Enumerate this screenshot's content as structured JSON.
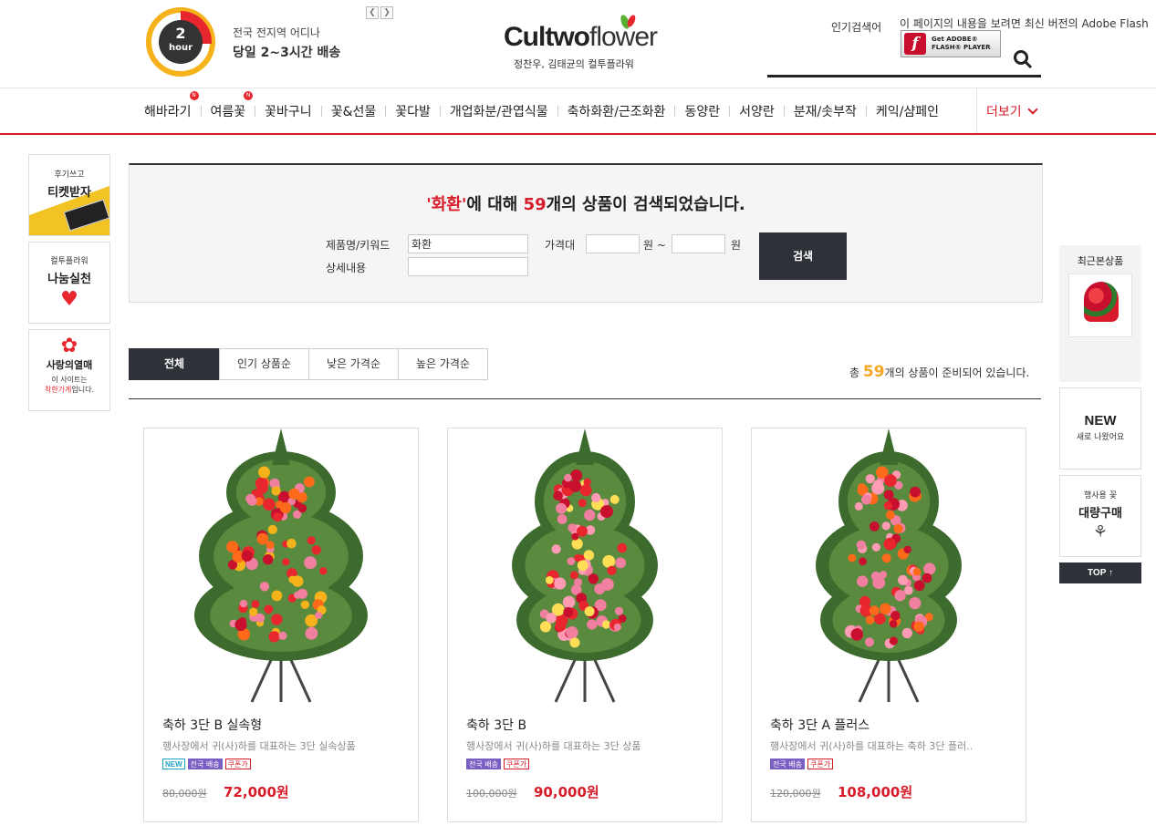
{
  "promo": {
    "clock_number": "2",
    "clock_unit": "hour",
    "line1": "전국 전지역 어디나",
    "line2": "당일 2~3시간 배송"
  },
  "logo": {
    "brand_bold": "Cultwo",
    "brand_light": "flower",
    "tagline": "정찬우, 김태균의 컬투플라워"
  },
  "header": {
    "popular_search": "인기검색어",
    "flash_message": "이 페이지의 내용을 보려면 최신 버전의 Adobe Flash",
    "flash_badge_line1": "Get ADOBE®",
    "flash_badge_line2": "FLASH® PLAYER",
    "flash_badge_icon": "f"
  },
  "nav": {
    "items": [
      {
        "label": "해바라기",
        "badge": "N"
      },
      {
        "label": "여름꽃",
        "badge": "N"
      },
      {
        "label": "꽃바구니"
      },
      {
        "label": "꽃&선물"
      },
      {
        "label": "꽃다발"
      },
      {
        "label": "개업화분/관엽식물"
      },
      {
        "label": "축하화환/근조화환"
      },
      {
        "label": "동양란"
      },
      {
        "label": "서양란"
      },
      {
        "label": "분재/솟부작"
      },
      {
        "label": "케익/샴페인"
      }
    ],
    "more": "더보기"
  },
  "left_banners": {
    "review": {
      "small": "후기쓰고",
      "big": "티켓받자"
    },
    "share": {
      "small": "컬투플라워",
      "big": "나눔실천"
    },
    "love": {
      "big": "사랑의열매",
      "line1": "이 사이트는",
      "line2_highlight": "착한가게",
      "line2_rest": "입니다."
    }
  },
  "right_bar": {
    "recent": "최근본상품",
    "new_big": "NEW",
    "new_small": "새로 나왔어요",
    "bulk_small": "행사용 꽃",
    "bulk_big": "대량구매",
    "top": "TOP ↑"
  },
  "search": {
    "title_keyword": "'화환'",
    "title_mid": "에 대해 ",
    "title_count": "59",
    "title_end": "개의 상품이 검색되었습니다.",
    "name_label": "제품명/키워드",
    "name_value": "화환",
    "price_label": "가격대",
    "won1": "원 ~",
    "won2": "원",
    "detail_label": "상세내용",
    "button": "검색"
  },
  "sort_tabs": [
    "전체",
    "인기 상품순",
    "낮은 가격순",
    "높은 가격순"
  ],
  "total": {
    "prefix": "총 ",
    "count": "59",
    "suffix": "개의 상품이 준비되어 있습니다."
  },
  "products": [
    {
      "name": "축하 3단 B 실속형",
      "desc": "행사장에서 귀(사)하를 대표하는 3단 실속상품",
      "tags": [
        "NEW",
        "전국 배송",
        "쿠폰가"
      ],
      "old_price": "80,000원",
      "price": "72,000원"
    },
    {
      "name": "축하 3단 B",
      "desc": "행사장에서 귀(사)하를 대표하는 3단 상품",
      "tags": [
        "전국 배송",
        "쿠폰가"
      ],
      "old_price": "100,000원",
      "price": "90,000원"
    },
    {
      "name": "축하 3단 A 플러스",
      "desc": "행사장에서 귀(사)하를 대표하는 축하 3단 플러..",
      "tags": [
        "전국 배송",
        "쿠폰가"
      ],
      "old_price": "120,000원",
      "price": "108,000원"
    }
  ]
}
